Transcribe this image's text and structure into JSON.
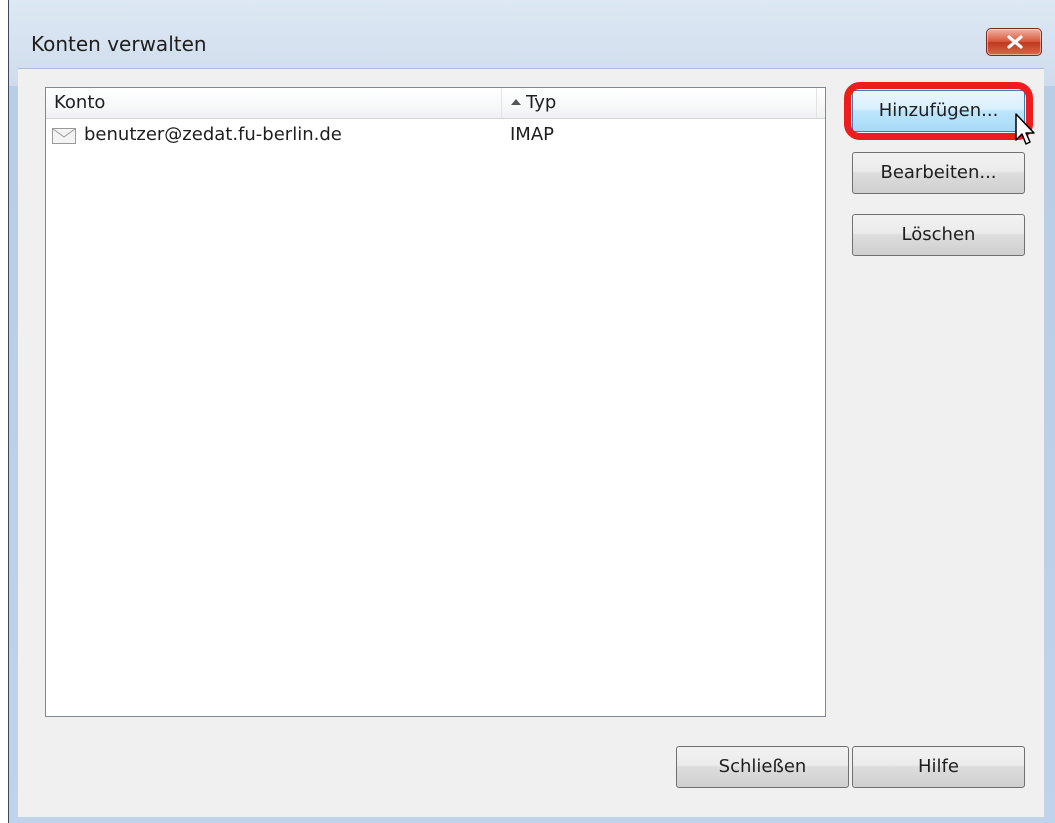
{
  "window": {
    "title": "Konten verwalten",
    "close_label": "close"
  },
  "list": {
    "columns": {
      "konto": "Konto",
      "typ": "Typ"
    },
    "sort_indicator": "ascending",
    "rows": [
      {
        "konto": "benutzer@zedat.fu-berlin.de",
        "typ": "IMAP",
        "icon": "mail-icon"
      }
    ]
  },
  "buttons": {
    "add": "Hinzufügen...",
    "edit": "Bearbeiten...",
    "delete": "Löschen",
    "close": "Schließen",
    "help": "Hilfe"
  },
  "annotation": {
    "highlight_color": "#ee1c1c"
  },
  "colors": {
    "close_button": "#c0381f",
    "hover_button": "#bee6fd"
  }
}
